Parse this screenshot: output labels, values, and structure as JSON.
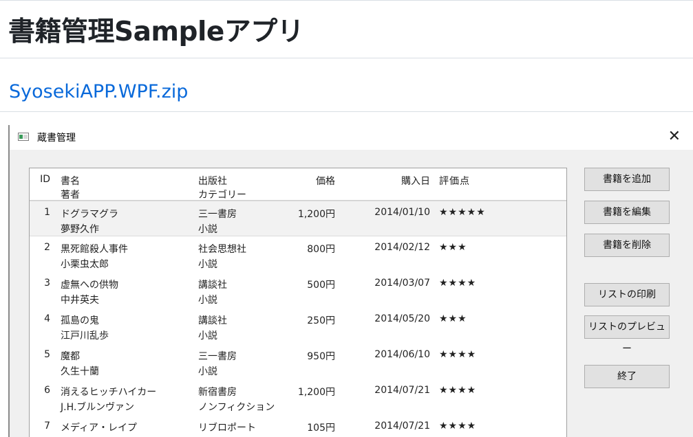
{
  "page": {
    "title": "書籍管理Sampleアプリ",
    "zip_link": "SyosekiAPP.WPF.zip"
  },
  "window": {
    "title": "蔵書管理",
    "close_glyph": "✕"
  },
  "list": {
    "headers": {
      "id": "ID",
      "title": "書名",
      "author": "著者",
      "publisher": "出版社",
      "category": "カテゴリー",
      "price": "価格",
      "purchase_date": "購入日",
      "rating": "評価点"
    },
    "rows": [
      {
        "id": "1",
        "title": "ドグラマグラ",
        "author": "夢野久作",
        "publisher": "三一書房",
        "category": "小説",
        "price": "1,200円",
        "date": "2014/01/10",
        "rating": "★★★★★"
      },
      {
        "id": "2",
        "title": "黒死館殺人事件",
        "author": "小栗虫太郎",
        "publisher": "社会思想社",
        "category": "小説",
        "price": "800円",
        "date": "2014/02/12",
        "rating": "★★★"
      },
      {
        "id": "3",
        "title": "虚無への供物",
        "author": "中井英夫",
        "publisher": "講談社",
        "category": "小説",
        "price": "500円",
        "date": "2014/03/07",
        "rating": "★★★★"
      },
      {
        "id": "4",
        "title": "孤島の鬼",
        "author": "江戸川乱歩",
        "publisher": "講談社",
        "category": "小説",
        "price": "250円",
        "date": "2014/05/20",
        "rating": "★★★"
      },
      {
        "id": "5",
        "title": "魔都",
        "author": "久生十蘭",
        "publisher": "三一書房",
        "category": "小説",
        "price": "950円",
        "date": "2014/06/10",
        "rating": "★★★★"
      },
      {
        "id": "6",
        "title": "消えるヒッチハイカー",
        "author": "J.H.ブルンヴァン",
        "publisher": "新宿書房",
        "category": "ノンフィクション",
        "price": "1,200円",
        "date": "2014/07/21",
        "rating": "★★★★"
      },
      {
        "id": "7",
        "title": "メディア・レイプ",
        "author": "",
        "publisher": "リブロポート",
        "category": "",
        "price": "105円",
        "date": "2014/07/21",
        "rating": "★★★★"
      }
    ]
  },
  "buttons": {
    "add": "書籍を追加",
    "edit": "書籍を編集",
    "delete": "書籍を削除",
    "print": "リストの印刷",
    "preview": "リストのプレビュー",
    "exit": "終了"
  }
}
